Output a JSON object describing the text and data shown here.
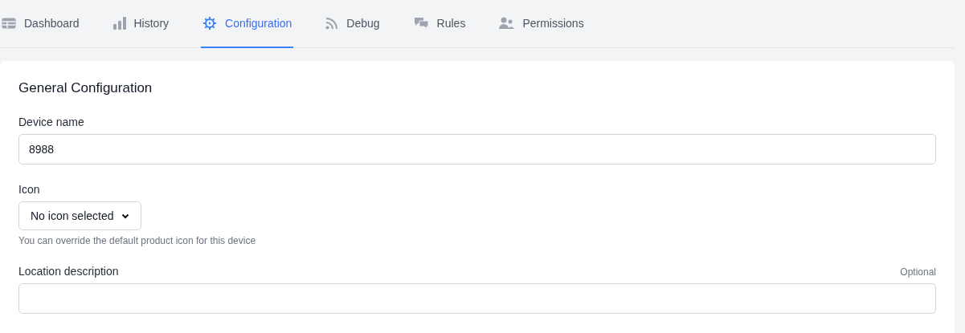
{
  "tabs": [
    {
      "label": "Dashboard",
      "selected": false
    },
    {
      "label": "History",
      "selected": false
    },
    {
      "label": "Configuration",
      "selected": true
    },
    {
      "label": "Debug",
      "selected": false
    },
    {
      "label": "Rules",
      "selected": false
    },
    {
      "label": "Permissions",
      "selected": false
    }
  ],
  "section": {
    "title": "General Configuration",
    "fields": [
      {
        "kind": "text",
        "label": "Device name",
        "value": "8988"
      },
      {
        "kind": "select",
        "label": "Icon",
        "value": "No icon selected",
        "help": "You can override the default product icon for this device"
      },
      {
        "kind": "text",
        "label": "Location description",
        "optional": "Optional"
      }
    ]
  }
}
